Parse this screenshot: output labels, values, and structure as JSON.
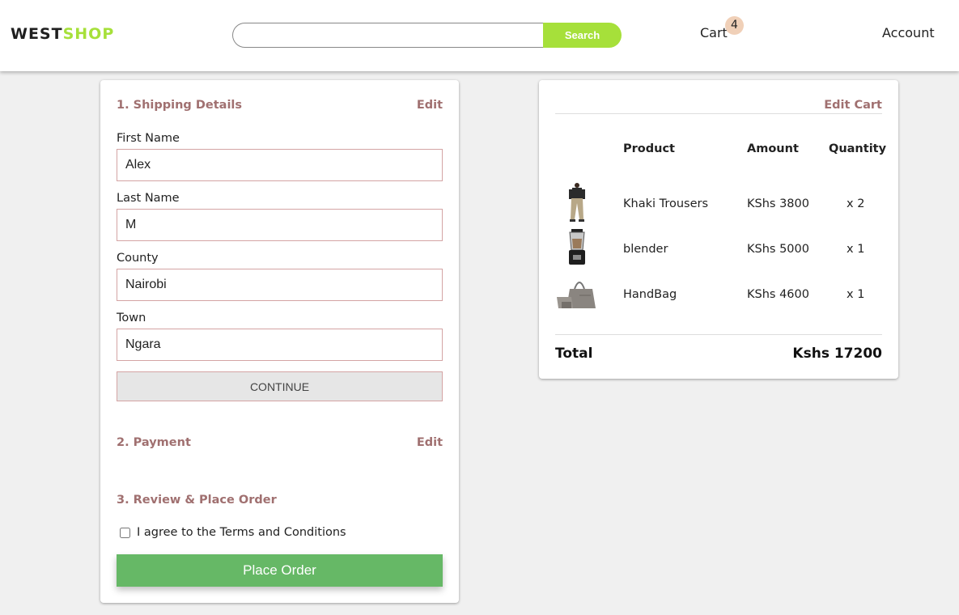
{
  "header": {
    "logo_part1": "WEST",
    "logo_part2": "SHOP",
    "search_value": "",
    "search_button": "Search",
    "cart_label": "Cart",
    "cart_count": "4",
    "account_label": "Account"
  },
  "checkout": {
    "shipping": {
      "title": "1. Shipping Details",
      "edit": "Edit",
      "fields": [
        {
          "label": "First Name",
          "value": "Alex"
        },
        {
          "label": "Last Name",
          "value": "M"
        },
        {
          "label": "County",
          "value": "Nairobi"
        },
        {
          "label": "Town",
          "value": "Ngara"
        }
      ],
      "continue_label": "CONTINUE"
    },
    "payment": {
      "title": "2. Payment",
      "edit": "Edit"
    },
    "review": {
      "title": "3. Review & Place Order",
      "terms_label": "I agree to the Terms and Conditions",
      "terms_checked": false,
      "place_order_label": "Place Order"
    }
  },
  "cart": {
    "edit_cart": "Edit Cart",
    "headers": {
      "product": "Product",
      "amount": "Amount",
      "quantity": "Quantity"
    },
    "items": [
      {
        "name": "Khaki Trousers",
        "amount": "KShs 3800",
        "quantity": "x 2",
        "icon": "trousers-thumbnail"
      },
      {
        "name": "blender",
        "amount": "KShs 5000",
        "quantity": "x 1",
        "icon": "blender-thumbnail"
      },
      {
        "name": "HandBag",
        "amount": "KShs 4600",
        "quantity": "x 1",
        "icon": "handbag-thumbnail"
      }
    ],
    "total_label": "Total",
    "total_value": "Kshs 17200"
  },
  "colors": {
    "accent_green": "#a6e03a",
    "place_order_green": "#66b866",
    "section_title": "#a07070",
    "background": "#f0f0f0"
  }
}
